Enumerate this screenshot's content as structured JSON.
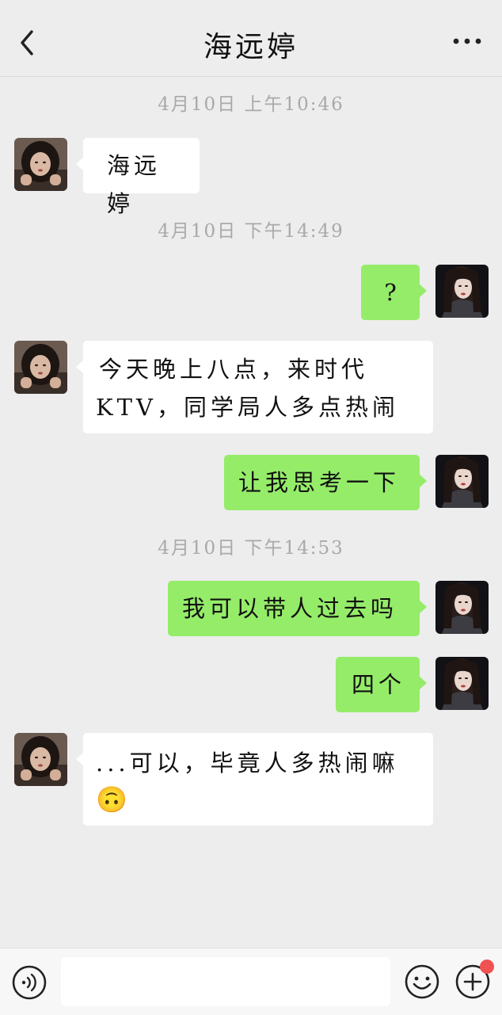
{
  "header": {
    "title": "海远婷",
    "back_icon": "chevron-left-icon",
    "more_icon": "more-dots-icon"
  },
  "timestamps": [
    "4月10日 上午10:46",
    "4月10日 下午14:49",
    "4月10日 下午14:53"
  ],
  "messages": [
    {
      "sender": "contact",
      "text": "海远婷"
    },
    {
      "sender": "me",
      "text": "?"
    },
    {
      "sender": "contact",
      "line1": "今天晚上八点，来时代",
      "line2": "KTV，同学局人多点热闹"
    },
    {
      "sender": "me",
      "text": "让我思考一下"
    },
    {
      "sender": "me",
      "text": "我可以带人过去吗"
    },
    {
      "sender": "me",
      "text": "四个"
    },
    {
      "sender": "contact",
      "text": "...可以，毕竟人多热闹嘛",
      "emoji": "🙃"
    }
  ],
  "input_bar": {
    "value": "",
    "voice_icon": "voice-icon",
    "emoji_icon": "smiley-icon",
    "plus_icon": "plus-icon",
    "badge_color": "#f05252"
  },
  "colors": {
    "background": "#ededed",
    "outgoing_bubble": "#95ec69",
    "incoming_bubble": "#ffffff",
    "timestamp": "#a9a9a9"
  }
}
